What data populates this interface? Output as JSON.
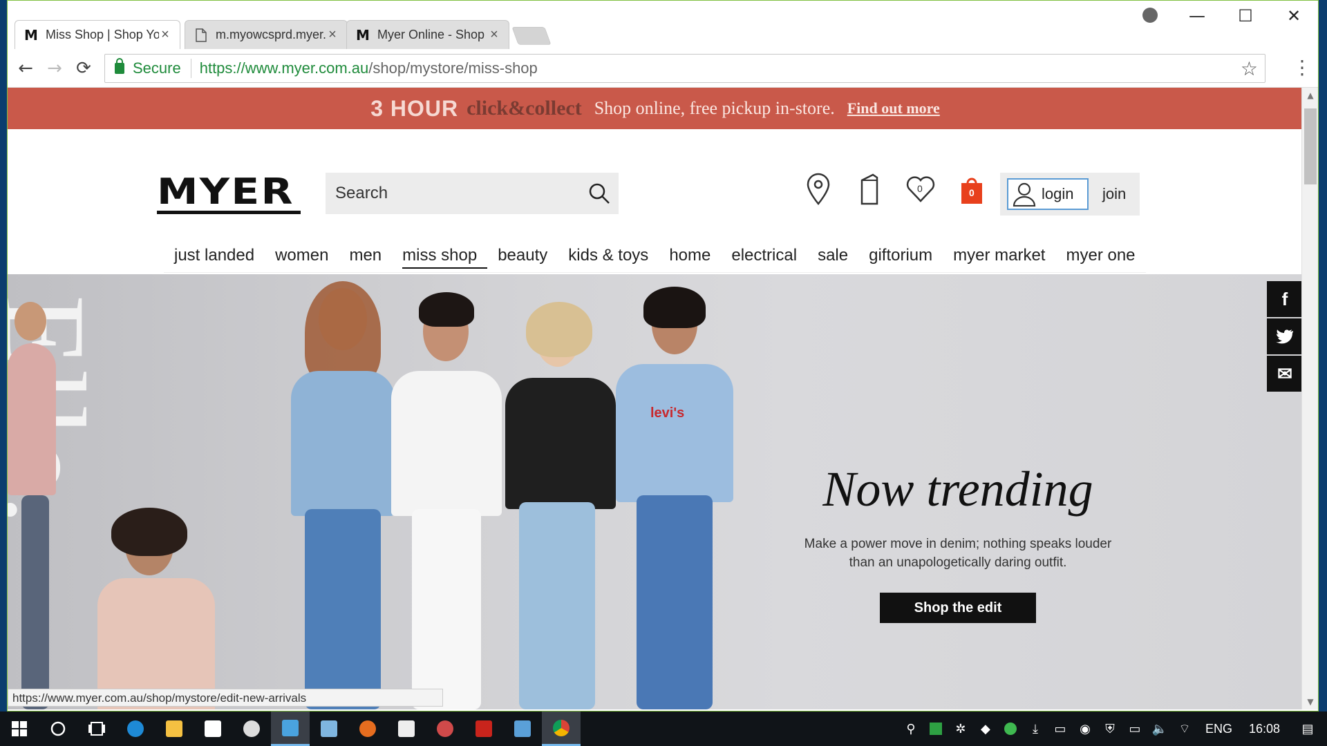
{
  "browser": {
    "tabs": [
      {
        "favicon": "M",
        "title": "Miss Shop | Shop Youth C",
        "close": "×",
        "active": true
      },
      {
        "favicon": "📄",
        "title": "m.myowcsprd.myer.com.",
        "close": "×",
        "active": false
      },
      {
        "favicon": "M",
        "title": "Myer Online - Shop Fash",
        "close": "×",
        "active": false
      }
    ],
    "window_controls": {
      "minimize": "—",
      "maximize": "☐",
      "close": "✕"
    },
    "nav": {
      "back": "←",
      "forward": "→",
      "reload": "⟳"
    },
    "omnibox": {
      "secure_label": "Secure",
      "url_host": "https://www.myer.com.au",
      "url_path": "/shop/mystore/miss-shop",
      "star": "☆"
    },
    "menu": "⋮",
    "status_url": "https://www.myer.com.au/shop/mystore/edit-new-arrivals"
  },
  "promo": {
    "headline": "3 HOUR",
    "headline2": "click&collect",
    "text": "Shop online, free pickup in-store.",
    "link": "Find out more"
  },
  "header": {
    "logo": "MYER",
    "search_placeholder": "Search",
    "wishlist_count": "0",
    "bag_count": "0",
    "login": "login",
    "join": "join"
  },
  "nav": {
    "items": [
      "just landed",
      "women",
      "men",
      "miss shop",
      "beauty",
      "kids & toys",
      "home",
      "electrical",
      "sale",
      "giftorium",
      "myer market",
      "myer one"
    ],
    "current": "miss shop"
  },
  "hero": {
    "side_word": "Elle.",
    "title": "Now trending",
    "body": "Make a power move in denim; nothing speaks louder than an unapologetically daring outfit.",
    "cta": "Shop the edit",
    "brand_tee": "levi's"
  },
  "social": [
    "f",
    "🐦",
    "✉"
  ],
  "taskbar": {
    "lang": "ENG",
    "time": "16:08"
  },
  "colors": {
    "promo_bg": "#c9594a",
    "bag_red": "#e8401c",
    "secure_green": "#1f8b3b"
  }
}
